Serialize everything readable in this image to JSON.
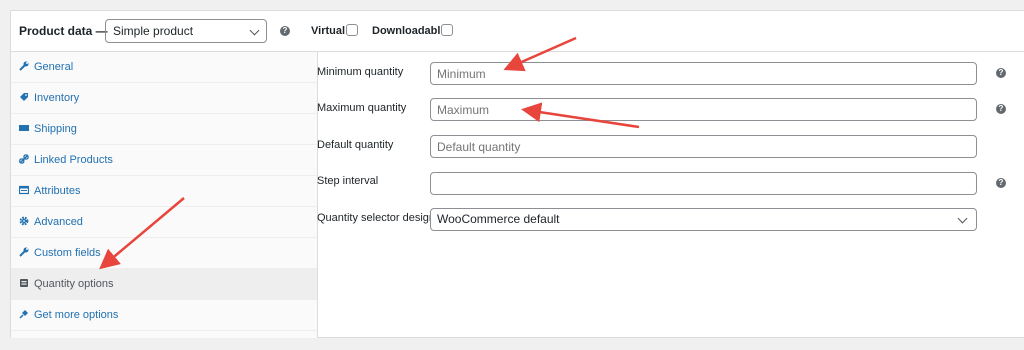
{
  "header": {
    "title": "Product data —",
    "product_type": "Simple product",
    "virtual_label": "Virtual:",
    "downloadable_label": "Downloadable:"
  },
  "sidebar": {
    "items": [
      {
        "label": "General",
        "icon": "wrench-icon"
      },
      {
        "label": "Inventory",
        "icon": "tag-icon"
      },
      {
        "label": "Shipping",
        "icon": "truck-icon"
      },
      {
        "label": "Linked Products",
        "icon": "link-icon"
      },
      {
        "label": "Attributes",
        "icon": "table-icon"
      },
      {
        "label": "Advanced",
        "icon": "gear-icon"
      },
      {
        "label": "Custom fields",
        "icon": "wrench-icon"
      },
      {
        "label": "Quantity options",
        "icon": "box-icon"
      },
      {
        "label": "Get more options",
        "icon": "plugin-icon"
      }
    ],
    "active_index": 7
  },
  "fields": [
    {
      "label": "Minimum quantity",
      "placeholder": "Minimum"
    },
    {
      "label": "Maximum quantity",
      "placeholder": "Maximum"
    },
    {
      "label": "Default quantity",
      "placeholder": "Default quantity"
    },
    {
      "label": "Step interval",
      "placeholder": ""
    },
    {
      "label": "Quantity selector design",
      "value": "WooCommerce default"
    }
  ],
  "colors": {
    "accent": "#2271b1",
    "annotation": "#e8453c"
  }
}
